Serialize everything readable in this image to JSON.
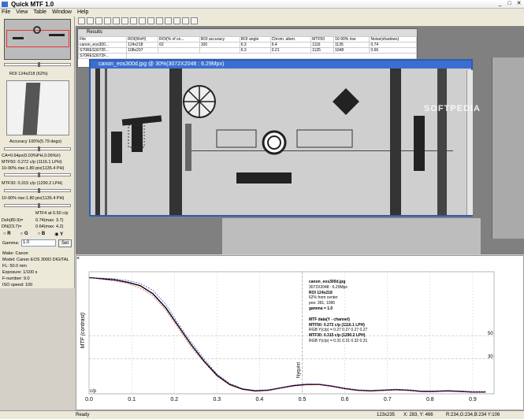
{
  "app": {
    "title": "Quick MTF 1.0"
  },
  "menu": [
    "File",
    "View",
    "Table",
    "Window",
    "Help"
  ],
  "left": {
    "roi": "ROI 124x218 (62%)",
    "accuracy": "Accuracy 100%(5.79 degs)",
    "ca": "CA=0.64px(0.03%PH,0.06%/r)",
    "mtf50": "MTF50: 0.272 c/p (1116.1 LPH)",
    "rise": "10-90% rise:1.80 pix(1135.4 PH)",
    "mtf30": "MTF30: 0.315 c/p (1290.2 LPH)",
    "rise2": "10-90% rise:1.80 pix(1135.4 PH)",
    "mtf4": "MTF4 at 0.50 c/p",
    "dsh_l": "Dsh(80.9)=",
    "dsh_v": "0.74(max: 3.7)",
    "dn_l": "DN(23.7)=",
    "dn_v": "0.64(max: 4.2)",
    "radios": [
      "R",
      "G",
      "B",
      "Y"
    ],
    "gamma_label": "Gamma:",
    "gamma_value": "1.0",
    "set": "Set",
    "info": [
      "Make: Canon",
      "Model: Canon EOS 300D DIGITAL",
      "FL: 50.0 mm",
      "Exposure: 1/100 s",
      "F-number: 9.0",
      "ISO speed: 100"
    ]
  },
  "results": {
    "title": "Results",
    "headers": [
      "File",
      "ROI(WxH)",
      "ROI(% of ce...",
      "ROI accuracy",
      "ROI angle",
      "Chrom. aberr.",
      "MTF50",
      "10-90% rise",
      "Noise(shadows)"
    ],
    "rows": [
      [
        "canon_eos300...",
        "124x218",
        "62",
        "100",
        "6.3",
        "6.4",
        "1116",
        "1135",
        "0.74"
      ],
      [
        "S70RES3072F...",
        "108x207",
        "",
        "",
        "6.3",
        "0.21",
        "1125",
        "1048",
        "0.66"
      ],
      [
        "S70RES3072F...",
        "",
        "",
        "",
        "",
        "",
        "",
        "",
        ""
      ],
      [
        "canon...",
        "",
        "",
        "",
        "",
        "",
        "",
        "",
        ""
      ]
    ]
  },
  "image_window": {
    "title": "canon_eos300d.jpg @ 30%(3072X2048 : 6.29Mpx)"
  },
  "watermark": "SOFTPEDIA",
  "chart_data": {
    "type": "line",
    "ylabel": "MTF (contrast)",
    "x_ticks": [
      "0.0",
      "0.1",
      "0.2",
      "0.3",
      "0.4",
      "0.5",
      "0.6",
      "0.7",
      "0.8",
      "0.9"
    ],
    "xlim": [
      0,
      0.95
    ],
    "ylim": [
      0,
      1.05
    ],
    "right_ticks": [
      "50",
      "30"
    ],
    "nyquist": "Nyquist",
    "cp": "c/p",
    "series": [
      {
        "color": "#000000",
        "x": [
          0,
          0.03,
          0.06,
          0.09,
          0.12,
          0.15,
          0.18,
          0.21,
          0.24,
          0.27,
          0.3,
          0.33,
          0.36,
          0.39,
          0.42,
          0.45,
          0.48,
          0.51,
          0.54,
          0.57,
          0.6,
          0.63,
          0.66,
          0.69,
          0.72,
          0.75,
          0.78,
          0.81,
          0.84,
          0.87,
          0.9,
          0.93
        ],
        "y": [
          1.0,
          0.99,
          0.98,
          0.96,
          0.93,
          0.86,
          0.74,
          0.58,
          0.42,
          0.28,
          0.16,
          0.08,
          0.04,
          0.025,
          0.03,
          0.05,
          0.07,
          0.08,
          0.08,
          0.065,
          0.045,
          0.03,
          0.025,
          0.03,
          0.035,
          0.03,
          0.02,
          0.02,
          0.025,
          0.02,
          0.015,
          0.015
        ]
      },
      {
        "color": "#d33",
        "x": [
          0,
          0.03,
          0.06,
          0.09,
          0.12,
          0.15,
          0.18,
          0.21,
          0.24,
          0.27,
          0.3,
          0.33,
          0.36,
          0.39,
          0.42,
          0.45,
          0.48,
          0.51,
          0.54,
          0.57,
          0.6,
          0.63,
          0.66,
          0.69,
          0.72,
          0.75,
          0.78,
          0.81,
          0.84,
          0.87,
          0.9,
          0.93
        ],
        "y": [
          1.0,
          0.985,
          0.97,
          0.95,
          0.91,
          0.84,
          0.72,
          0.56,
          0.4,
          0.27,
          0.15,
          0.075,
          0.035,
          0.02,
          0.028,
          0.048,
          0.066,
          0.076,
          0.077,
          0.062,
          0.043,
          0.028,
          0.022,
          0.028,
          0.033,
          0.028,
          0.018,
          0.018,
          0.022,
          0.018,
          0.014,
          0.014
        ]
      },
      {
        "color": "#33c",
        "x": [
          0,
          0.03,
          0.06,
          0.09,
          0.12,
          0.15,
          0.18,
          0.21,
          0.24,
          0.27,
          0.3,
          0.33,
          0.36,
          0.39,
          0.42,
          0.45,
          0.48,
          0.51,
          0.54,
          0.57,
          0.6,
          0.63,
          0.66,
          0.69,
          0.72,
          0.75,
          0.78,
          0.81,
          0.84,
          0.87,
          0.9,
          0.93
        ],
        "y": [
          1.0,
          0.995,
          0.99,
          0.975,
          0.95,
          0.89,
          0.77,
          0.6,
          0.44,
          0.3,
          0.17,
          0.09,
          0.045,
          0.03,
          0.035,
          0.055,
          0.075,
          0.085,
          0.085,
          0.07,
          0.05,
          0.035,
          0.03,
          0.035,
          0.04,
          0.035,
          0.025,
          0.025,
          0.03,
          0.025,
          0.02,
          0.02
        ]
      }
    ],
    "legend": {
      "file": "canon_eos300d.jpg",
      "size": "3072X2048 : 6.29Mpx",
      "roi": "ROI 124x218",
      "center": "62% from center",
      "pos": "pos: 391, 1095",
      "gamma": "gamma = 1.0",
      "mtf_title": "MTF data(Y - channel)",
      "mtf50": "MTF50: 0.272 c/p (1116.1 LPH)",
      "mtf50rgb": "RGB Y(c/p) = 0.27 0.27 0.27 0.27",
      "mtf30": "MTF30: 0.315 c/p (1290.2 LPH)",
      "mtf30rgb": "RGB Y(c/p) = 0.31 0.31 0.32 0.31"
    }
  },
  "status": {
    "ready": "Ready",
    "roi": "123x235",
    "xy": "X: 283, Y: 466",
    "rgb": "R:234,G:234,B:234 Y:106"
  }
}
